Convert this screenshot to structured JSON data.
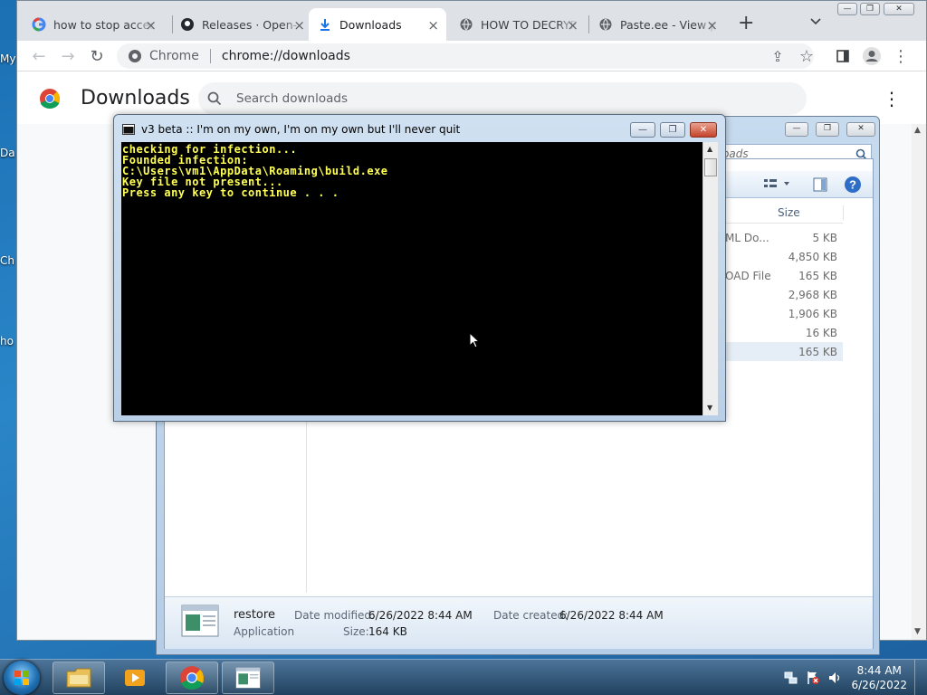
{
  "desktop": {
    "icon_labels": [
      "My",
      "Da",
      "Ch",
      "ho"
    ]
  },
  "chrome": {
    "tabs": [
      {
        "label": "how to stop access",
        "icon": "google-g-icon",
        "active": false
      },
      {
        "label": "Releases · Open-",
        "icon": "github-icon",
        "active": false
      },
      {
        "label": "Downloads",
        "icon": "download-icon",
        "active": true
      },
      {
        "label": "HOW TO DECRYPT",
        "icon": "globe-icon",
        "active": false
      },
      {
        "label": "Paste.ee - View p",
        "icon": "globe-icon",
        "active": false
      }
    ],
    "omnibox": {
      "site_label": "Chrome",
      "url": "chrome://downloads"
    },
    "page": {
      "title": "Downloads",
      "search_placeholder": "Search downloads"
    }
  },
  "explorer": {
    "search_placeholder": "oads",
    "column_header": "Size",
    "rows": [
      {
        "type": "ML Do...",
        "size": "5 KB"
      },
      {
        "type": "",
        "size": "4,850 KB"
      },
      {
        "type": "OAD File",
        "size": "165 KB"
      },
      {
        "type": "",
        "size": "2,968 KB"
      },
      {
        "type": "",
        "size": "1,906 KB"
      },
      {
        "type": "",
        "size": "16 KB"
      },
      {
        "type": "",
        "size": "165 KB",
        "selected": true
      }
    ],
    "details": {
      "name": "restore",
      "type": "Application",
      "date_modified_label": "Date modified:",
      "date_modified": "6/26/2022 8:44 AM",
      "date_created_label": "Date created:",
      "date_created": "6/26/2022 8:44 AM",
      "size_label": "Size:",
      "size": "164 KB"
    }
  },
  "console": {
    "title": "v3 beta :: I'm on my own, I'm on my own but I'll never quit",
    "lines": [
      "checking for infection...",
      "Founded infection:",
      "C:\\Users\\vm1\\AppData\\Roaming\\build.exe",
      "Key file not present...",
      "Press any key to continue . . ."
    ],
    "text_color": "#ffff55"
  },
  "taskbar": {
    "clock_time": "8:44 AM",
    "clock_date": "6/26/2022"
  }
}
